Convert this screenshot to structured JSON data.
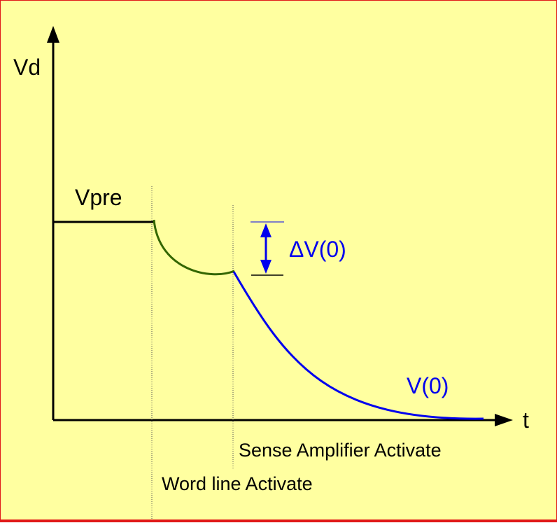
{
  "y_axis_label": "Vd",
  "x_axis_label": "t",
  "vpre_label": "Vpre",
  "delta_label": "ΔV(0)",
  "curve_label": "V(0)",
  "sense_amp_label": "Sense Amplifier Activate",
  "word_line_label": "Word line Activate",
  "colors": {
    "background": "#ffffa0",
    "border": "#e01818",
    "axis": "#000000",
    "precharge_line": "#000000",
    "charge_share_curve": "#336600",
    "amplified_curve": "#0000ee",
    "delta_marker": "#0000ee"
  }
}
